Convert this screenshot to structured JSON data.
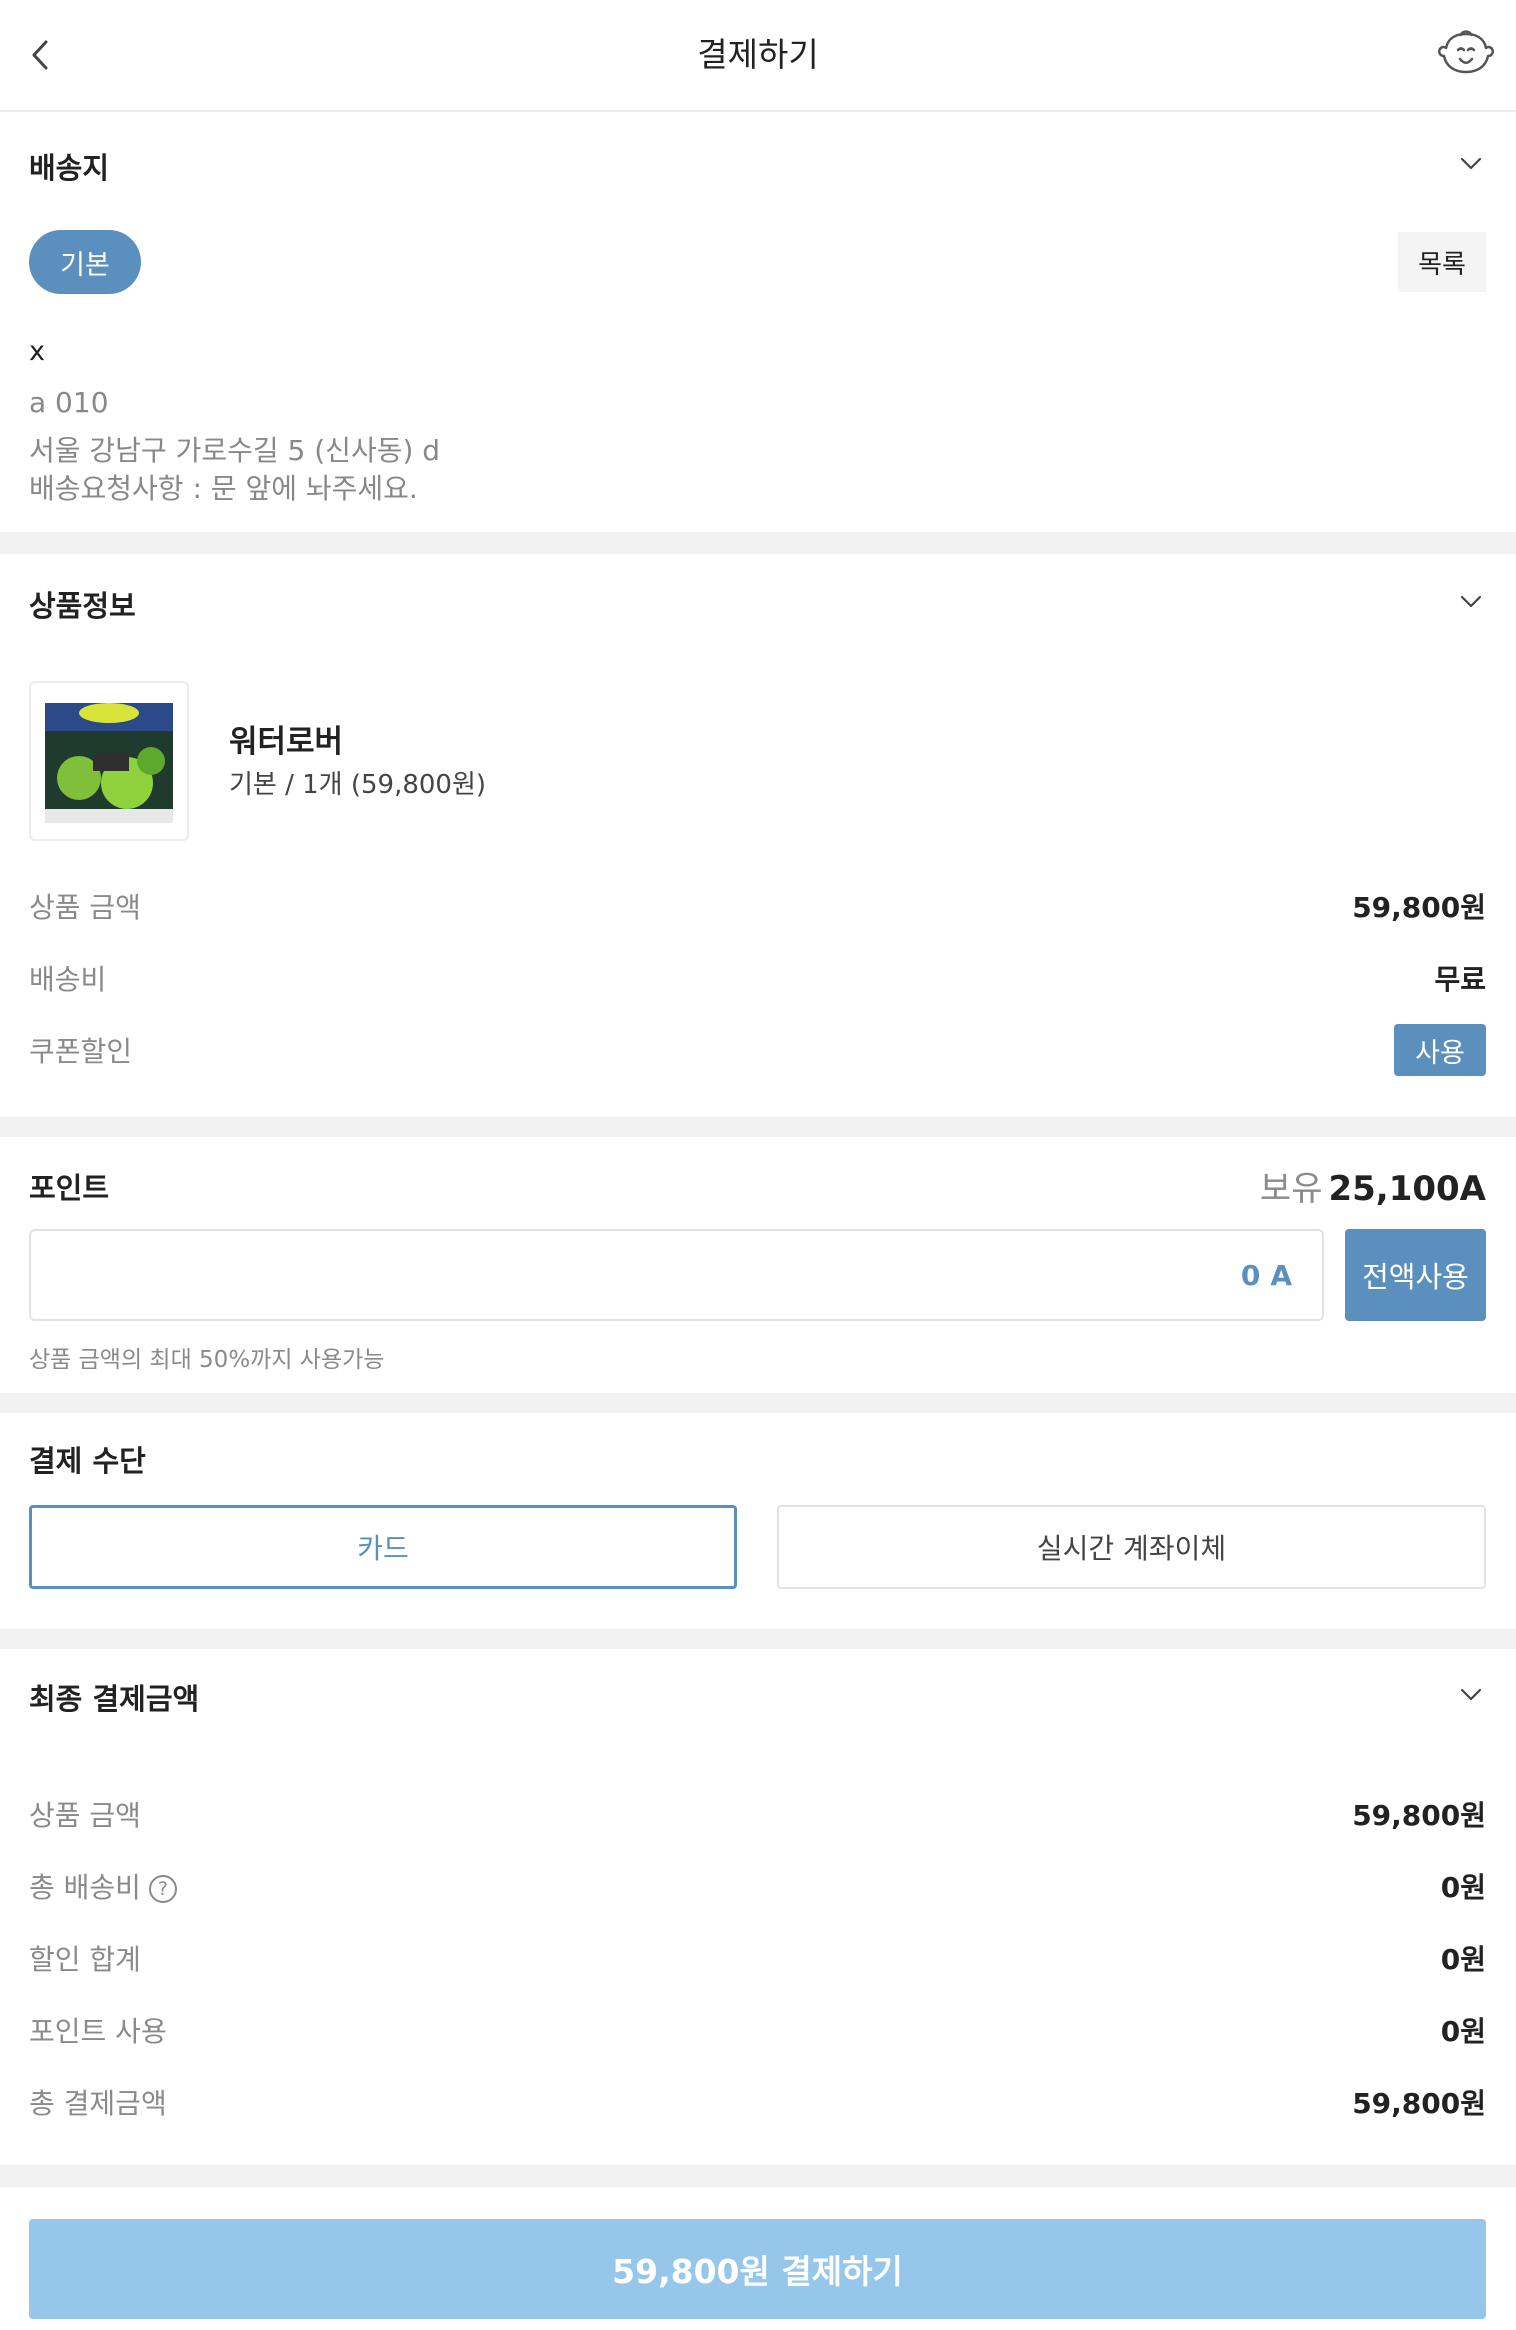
{
  "header": {
    "title": "결제하기",
    "back_icon": "chevron-left-icon",
    "profile_icon": "baby-face-icon"
  },
  "shipping": {
    "title": "배송지",
    "default_label": "기본",
    "list_label": "목록",
    "name": "x",
    "phone": "a 010",
    "address": "서울 강남구 가로수길 5 (신사동) d",
    "request": "배송요청사항 : 문 앞에 놔주세요."
  },
  "product": {
    "title": "상품정보",
    "name": "워터로버",
    "option": "기본 / 1개 (59,800원)",
    "price_label": "상품 금액",
    "price_value": "59,800원",
    "shipping_label": "배송비",
    "shipping_value": "무료",
    "coupon_label": "쿠폰할인",
    "coupon_button": "사용"
  },
  "points": {
    "title": "포인트",
    "held_label": "보유",
    "held_value": "25,100A",
    "input_value": "0",
    "input_unit": "A",
    "use_all_button": "전액사용",
    "note": "상품 금액의 최대 50%까지 사용가능"
  },
  "payment_method": {
    "title": "결제 수단",
    "options": [
      "카드",
      "실시간 계좌이체"
    ],
    "selected": "카드"
  },
  "summary": {
    "title": "최종 결제금액",
    "rows": [
      {
        "label": "상품 금액",
        "value": "59,800원"
      },
      {
        "label": "총 배송비",
        "value": "0원"
      },
      {
        "label": "할인 합계",
        "value": "0원"
      },
      {
        "label": "포인트 사용",
        "value": "0원"
      },
      {
        "label": "총 결제금액",
        "value": "59,800원"
      }
    ]
  },
  "footer": {
    "pay_button": "59,800원 결제하기"
  },
  "colors": {
    "accent": "#5b8fbd",
    "pay_button": "#96c7ea",
    "section_gap": "#f2f2f2"
  }
}
